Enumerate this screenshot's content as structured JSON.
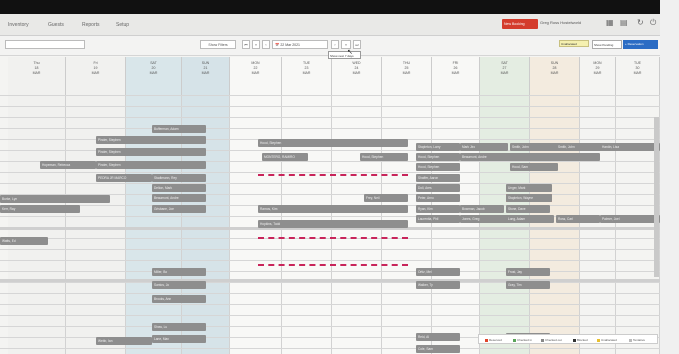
{
  "nav": {
    "items": [
      "Inventory",
      "Guests",
      "Reports",
      "Setup"
    ],
    "red_button": "New Booking",
    "user": "Greg Ross Hostelworld"
  },
  "toolbar": {
    "filter_label": "Show Filters",
    "date": "22 Mar 2021",
    "tooltip": "Show next 7 days",
    "tentative": "Unallocated",
    "grey_btn": "Show Pending",
    "blue_btn": "+ Reservation"
  },
  "days": [
    {
      "d": "Thu",
      "n": "18",
      "m": "MAR"
    },
    {
      "d": "Fri",
      "n": "19",
      "m": "MAR"
    },
    {
      "d": "SAT",
      "n": "20",
      "m": "MAR"
    },
    {
      "d": "SUN",
      "n": "21",
      "m": "MAR"
    },
    {
      "d": "MON",
      "n": "22",
      "m": "MAR"
    },
    {
      "d": "TUE",
      "n": "23",
      "m": "MAR"
    },
    {
      "d": "WED",
      "n": "24",
      "m": "MAR"
    },
    {
      "d": "THU",
      "n": "25",
      "m": "MAR"
    },
    {
      "d": "FRI",
      "n": "26",
      "m": "MAR"
    },
    {
      "d": "SAT",
      "n": "27",
      "m": "MAR"
    },
    {
      "d": "SUN",
      "n": "28",
      "m": "MAR"
    },
    {
      "d": "MON",
      "n": "29",
      "m": "MAR"
    },
    {
      "d": "TUE",
      "n": "30",
      "m": "MAR"
    }
  ],
  "bookings": [
    "Bufferman, Adam",
    "Pinder, Stephen",
    "Pinder, Stephen",
    "Hopeman, Rebecca",
    "Pinder, Stephen",
    "PEDRA JR MARCO",
    "Stadtmann, Rey",
    "Delton, Mark",
    "Beaumont, Andre",
    "Grisbane, Joe",
    "Hood, Stephen",
    "MONTERO, RAMIRO",
    "Hood, Stephen",
    "Stapleton, Larry",
    "Hood, Stephen",
    "Hood, Stephen",
    "Shaffer, Aaron",
    "Doll, Ares",
    "Mark Jiro",
    "Smith, John",
    "Smith, John",
    "Beaumont, Andre",
    "Hood, Sam",
    "Bradshaw, Jesse",
    "Unger, Mark",
    "Stapleton, Wayne",
    "Ramos, Kim",
    "Hopkins, Todd",
    "Frey, Neil",
    "Peter, Arno",
    "Ryan, Kim",
    "Laurentia, Phil",
    "Bowman, Jacob",
    "Jones, Greg",
    "Stone, Dave",
    "Long, Adam",
    "Ross, Carl",
    "Palmer, Joel",
    "Hardin, Lisa",
    "Miller, Bo",
    "Santos, Jo",
    "Brooks, Ann",
    "Ortiz, Mel",
    "Walker, Ty",
    "Frost, Jay",
    "Gray, Tim",
    "Shaw, Lu",
    "Lane, Max",
    "Webb, Ian",
    "Reid, Al",
    "Cole, Sam",
    "Holt, Dee",
    "Watts, Ed",
    "Burke, Lyn",
    "Kerr, Ray"
  ],
  "legend": [
    "Reserved",
    "Checked in",
    "Checked out",
    "Blocked",
    "Unallocated",
    "Tentative"
  ],
  "colors": {
    "accent_red": "#d43c2c",
    "accent_blue": "#2b6cc4",
    "highlight": "#c8245a",
    "booking": "#8e8e8e"
  }
}
